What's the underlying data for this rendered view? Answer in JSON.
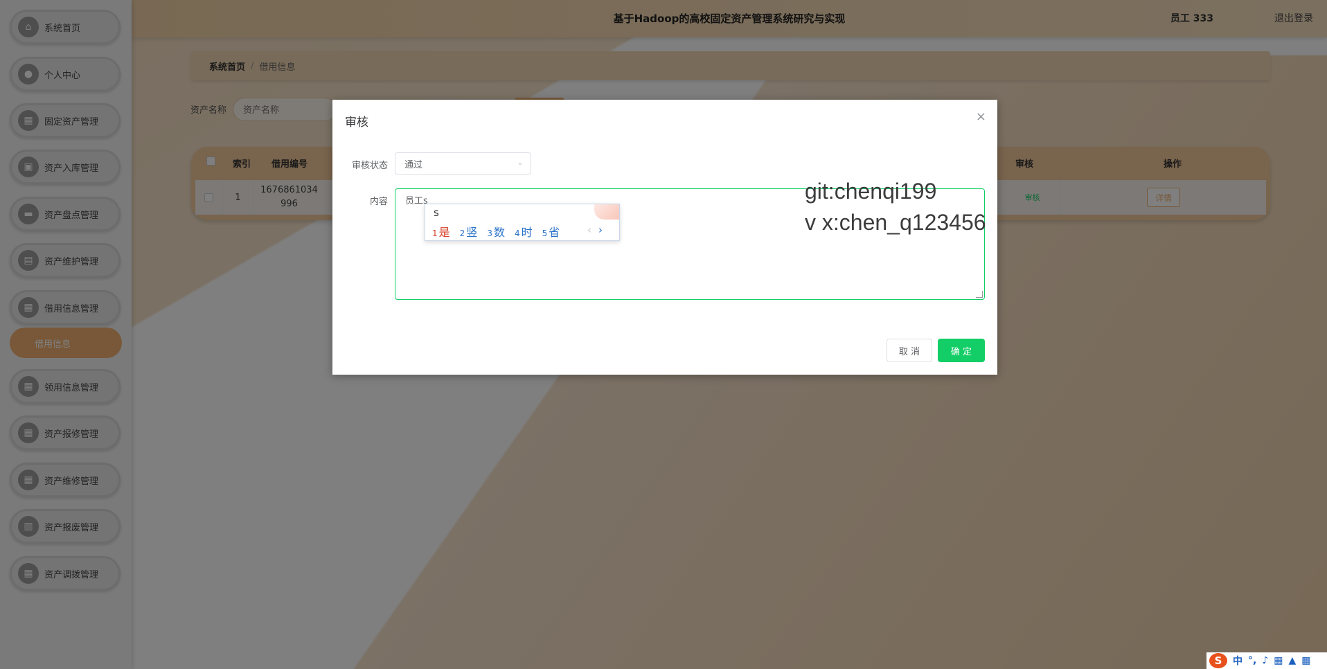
{
  "header": {
    "title": "基于Hadoop的高校固定资产管理系统研究与实现",
    "user": "员工 333",
    "logout": "退出登录"
  },
  "sidebar": {
    "items": [
      {
        "label": "系统首页",
        "icon": "home-icon",
        "glyph": "⌂"
      },
      {
        "label": "个人中心",
        "icon": "user-icon",
        "glyph": "●"
      },
      {
        "label": "固定资产管理",
        "icon": "grid-icon",
        "glyph": "▦"
      },
      {
        "label": "资产入库管理",
        "icon": "briefcase-icon",
        "glyph": "▣"
      },
      {
        "label": "资产盘点管理",
        "icon": "box-icon",
        "glyph": "▬"
      },
      {
        "label": "资产维护管理",
        "icon": "clipboard-icon",
        "glyph": "▤"
      },
      {
        "label": "借用信息管理",
        "icon": "grid-icon",
        "glyph": "▦"
      },
      {
        "label": "领用信息管理",
        "icon": "grid-icon",
        "glyph": "▦"
      },
      {
        "label": "资产报修管理",
        "icon": "grid-icon",
        "glyph": "▦"
      },
      {
        "label": "资产维修管理",
        "icon": "grid-icon",
        "glyph": "▦"
      },
      {
        "label": "资产报废管理",
        "icon": "chart-icon",
        "glyph": "▥"
      },
      {
        "label": "资产调拨管理",
        "icon": "grid-icon",
        "glyph": "▦"
      }
    ],
    "active_sub": "借用信息"
  },
  "breadcrumb": {
    "home": "系统首页",
    "separator": "/",
    "current": "借用信息"
  },
  "search": {
    "label": "资产名称",
    "placeholder": "资产名称"
  },
  "table": {
    "headers": {
      "index": "索引",
      "borrow_no": "借用编号",
      "audit": "审核",
      "actions": "操作"
    },
    "row": {
      "index": "1",
      "borrow_no": "1676861034996",
      "audit": "审核",
      "detail": "详情"
    }
  },
  "dialog": {
    "title": "审核",
    "close": "×",
    "status_label": "审核状态",
    "status_value": "通过",
    "content_label": "内容",
    "content_value": "员工s",
    "cancel": "取 消",
    "confirm": "确 定",
    "watermark_line1": "git:chenqi199",
    "watermark_line2": "v x:chen_q123456"
  },
  "ime": {
    "composition": "s",
    "candidates": [
      {
        "num": "1",
        "text": "是"
      },
      {
        "num": "2",
        "text": "竖"
      },
      {
        "num": "3",
        "text": "数"
      },
      {
        "num": "4",
        "text": "时"
      },
      {
        "num": "5",
        "text": "省"
      }
    ],
    "prev": "‹",
    "next": "›"
  },
  "tray": {
    "logo": "S",
    "lang": "中",
    "punct": "°,"
  },
  "colors": {
    "accent": "#f0b070",
    "confirm": "#13ce66",
    "mask": "rgba(0,0,0,0.5)"
  }
}
